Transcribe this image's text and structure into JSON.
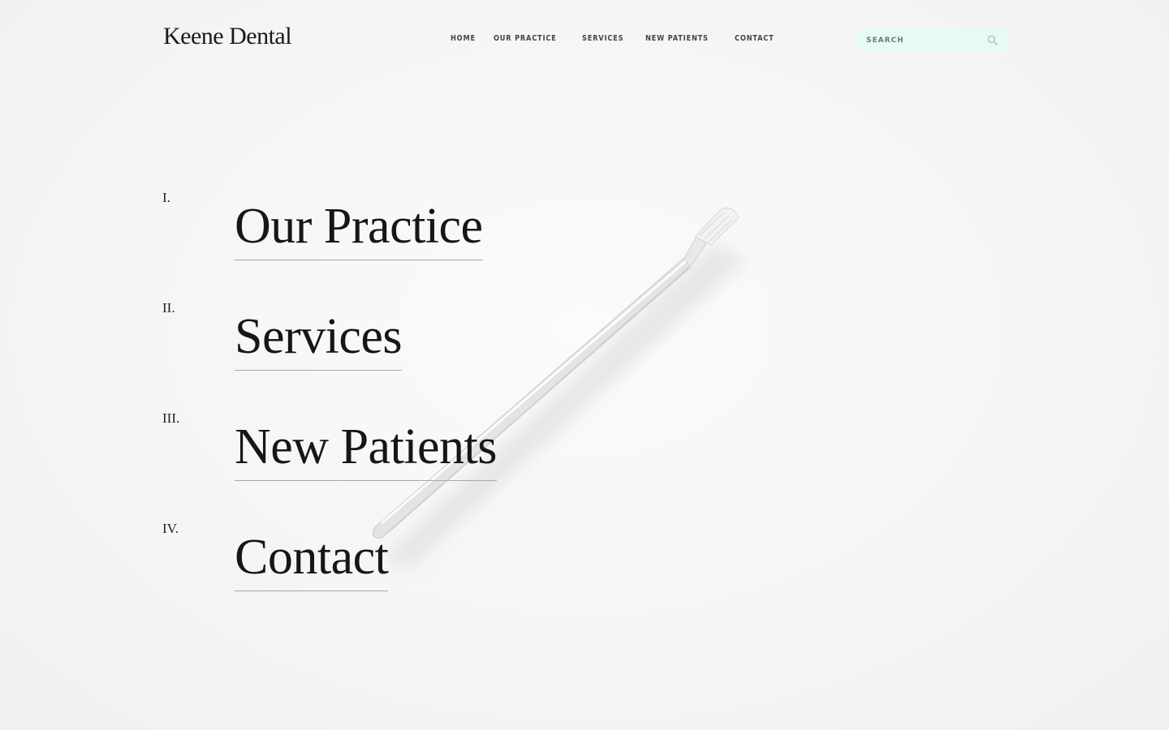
{
  "brand": {
    "logo": "Keene Dental"
  },
  "nav": {
    "items": [
      {
        "label": "HOME",
        "name": "nav-home"
      },
      {
        "label": "OUR PRACTICE",
        "name": "nav-our-practice"
      },
      {
        "label": "SERVICES",
        "name": "nav-services"
      },
      {
        "label": "NEW PATIENTS",
        "name": "nav-new-patients"
      },
      {
        "label": "CONTACT",
        "name": "nav-contact"
      }
    ]
  },
  "search": {
    "placeholder": "SEARCH",
    "icon": "search-icon",
    "background": "#e8fbf3"
  },
  "menu": {
    "items": [
      {
        "numeral": "I.",
        "label": "Our Practice"
      },
      {
        "numeral": "II.",
        "label": "Services"
      },
      {
        "numeral": "III.",
        "label": "New Patients"
      },
      {
        "numeral": "IV.",
        "label": "Contact"
      }
    ]
  },
  "hero": {
    "image": "toothbrush-photo"
  }
}
